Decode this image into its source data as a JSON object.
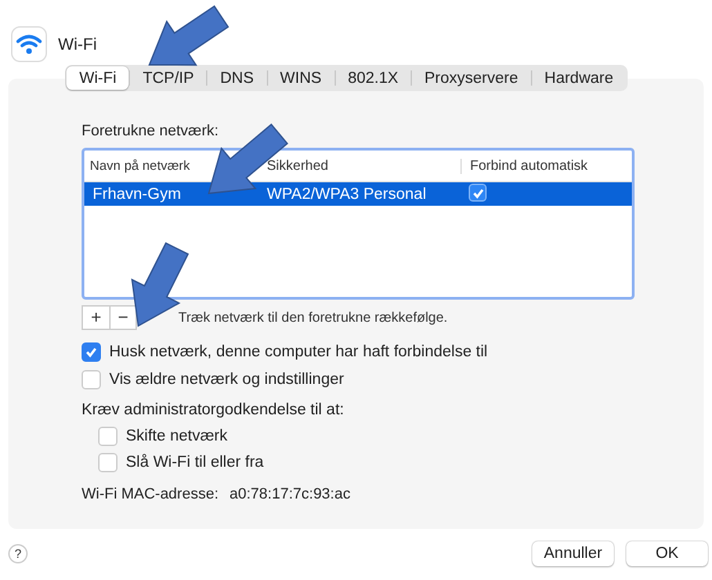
{
  "window": {
    "title": "Wi-Fi"
  },
  "tabs": [
    {
      "label": "Wi-Fi",
      "selected": true
    },
    {
      "label": "TCP/IP",
      "selected": false
    },
    {
      "label": "DNS",
      "selected": false
    },
    {
      "label": "WINS",
      "selected": false
    },
    {
      "label": "802.1X",
      "selected": false
    },
    {
      "label": "Proxyservere",
      "selected": false
    },
    {
      "label": "Hardware",
      "selected": false
    }
  ],
  "preferred_networks": {
    "label": "Foretrukne netværk:",
    "columns": [
      "Navn på netværk",
      "Sikkerhed",
      "Forbind automatisk"
    ],
    "rows": [
      {
        "name": "Frhavn-Gym",
        "security": "WPA2/WPA3 Personal",
        "auto_join": true,
        "selected": true
      }
    ]
  },
  "list_buttons": [
    "+",
    "−"
  ],
  "hint": "Træk netværk til den foretrukne rækkefølge.",
  "options": [
    {
      "label": "Husk netværk, denne computer har haft forbindelse til",
      "checked": true
    },
    {
      "label": "Vis ældre netværk og indstillinger",
      "checked": false
    }
  ],
  "admin_label": "Kræv administratorgodkendelse til at:",
  "admin_options": [
    {
      "label": "Skifte netværk",
      "checked": false
    },
    {
      "label": "Slå Wi-Fi til eller fra",
      "checked": false
    }
  ],
  "mac": {
    "label": "Wi-Fi MAC-adresse:",
    "value": "a0:78:17:7c:93:ac"
  },
  "help": "?",
  "buttons": [
    "Annuller",
    "OK"
  ]
}
